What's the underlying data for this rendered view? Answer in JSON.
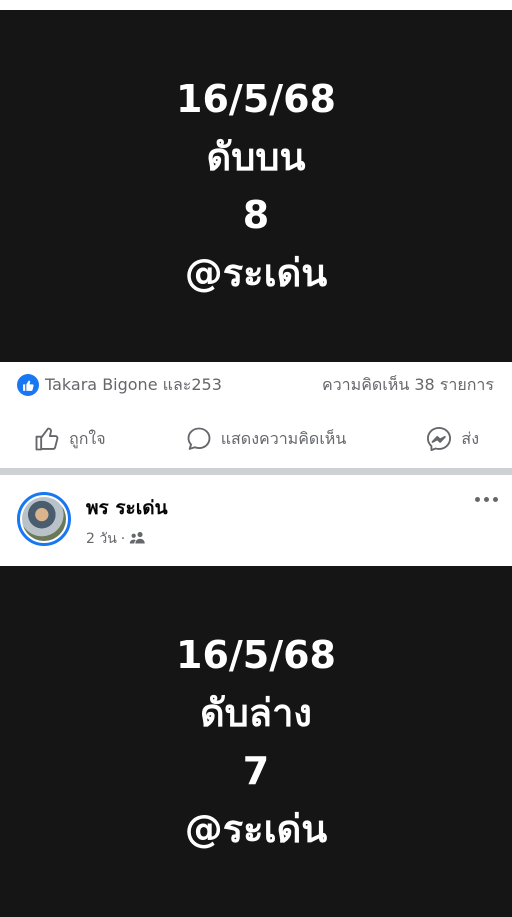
{
  "post1": {
    "image_lines": [
      "16/5/68",
      "ดับบน",
      "8",
      "@ระเด่น"
    ]
  },
  "reactions": {
    "names": "Takara Bigone และ253",
    "comments_count": "ความคิดเห็น 38 รายการ"
  },
  "actions": {
    "like_label": "ถูกใจ",
    "comment_label": "แสดงความคิดเห็น",
    "share_label": "ส่ง"
  },
  "post2": {
    "author": "พร ระเด่น",
    "time": "2 วัน",
    "separator": "·",
    "audience_icon": "friends-icon",
    "image_lines": [
      "16/5/68",
      "ดับล่าง",
      "7",
      "@ระเด่น"
    ]
  },
  "colors": {
    "background": "#ffffff",
    "image_background": "#151515",
    "accent": "#1877f2",
    "muted_text": "#65676b",
    "separator": "#ced0d4"
  }
}
